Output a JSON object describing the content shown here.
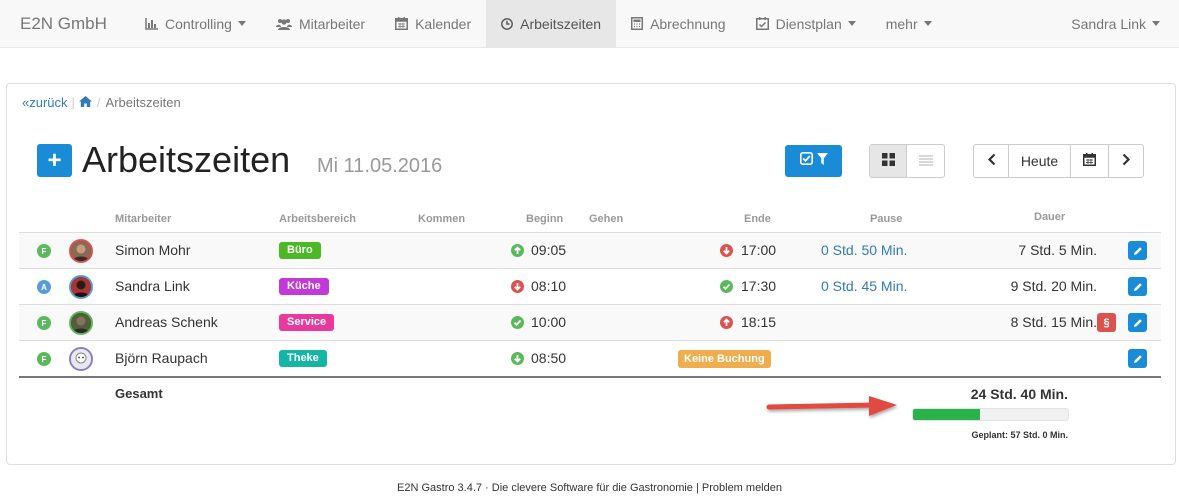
{
  "navbar": {
    "brand": "E2N GmbH",
    "items": [
      {
        "label": "Controlling",
        "icon": "bar-chart-icon",
        "dropdown": true
      },
      {
        "label": "Mitarbeiter",
        "icon": "users-icon",
        "dropdown": false
      },
      {
        "label": "Kalender",
        "icon": "calendar-icon",
        "dropdown": false
      },
      {
        "label": "Arbeitszeiten",
        "icon": "clock-icon",
        "dropdown": false,
        "active": true
      },
      {
        "label": "Abrechnung",
        "icon": "calculator-icon",
        "dropdown": false
      },
      {
        "label": "Dienstplan",
        "icon": "calendar-check-icon",
        "dropdown": true
      },
      {
        "label": "mehr",
        "dropdown": true
      }
    ],
    "user": "Sandra Link"
  },
  "breadcrumb": {
    "back": "zurück",
    "current": "Arbeitszeiten"
  },
  "header": {
    "add_label": "+",
    "title": "Arbeitszeiten",
    "date": "Mi 11.05.2016"
  },
  "toolbar": {
    "today": "Heute"
  },
  "table": {
    "columns": {
      "mitarbeiter": "Mitarbeiter",
      "arbeitsbereich": "Arbeitsbereich",
      "kommen": "Kommen",
      "beginn": "Beginn",
      "gehen": "Gehen",
      "ende": "Ende",
      "pause": "Pause",
      "dauer": "Dauer"
    },
    "rows": [
      {
        "status": "F",
        "status_color": "#5cb85c",
        "name": "Simon Mohr",
        "area": "Büro",
        "area_color": "#4cb826",
        "begin": "09:05",
        "begin_icon": "arrow-up",
        "end": "17:00",
        "end_icon": "arrow-down",
        "pause": "0 Std. 50 Min.",
        "dauer": "7 Std. 5 Min.",
        "avatar_border": "#d9534f"
      },
      {
        "status": "A",
        "status_color": "#5b9bd5",
        "name": "Sandra Link",
        "area": "Küche",
        "area_color": "#c13ad8",
        "begin": "08:10",
        "begin_icon": "arrow-down",
        "end": "17:30",
        "end_icon": "check",
        "pause": "0 Std. 45 Min.",
        "dauer": "9 Std. 20 Min.",
        "avatar_border": "#5b9bd5"
      },
      {
        "status": "F",
        "status_color": "#5cb85c",
        "name": "Andreas Schenk",
        "area": "Service",
        "area_color": "#e83a9c",
        "begin": "10:00",
        "begin_icon": "check",
        "end": "18:15",
        "end_icon": "arrow-up",
        "pause": "",
        "dauer": "8 Std. 15 Min.",
        "avatar_border": "#5cb85c",
        "paragraph": "§"
      },
      {
        "status": "F",
        "status_color": "#5cb85c",
        "name": "Björn Raupach",
        "area": "Theke",
        "area_color": "#14b5a5",
        "begin": "08:50",
        "begin_icon": "arrow-down-green",
        "end": "",
        "end_badge": "Keine Buchung",
        "pause": "",
        "dauer": "",
        "avatar_border": "#8e7cc3"
      }
    ],
    "total_label": "Gesamt",
    "total_value": "24 Std. 40 Min.",
    "progress_percent": 43,
    "planned": "Geplant: 57 Std. 0 Min."
  },
  "footer": {
    "text": "E2N Gastro 3.4.7 · Die clevere Software für die Gastronomie | Problem melden"
  },
  "colors": {
    "primary": "#1a8bd6",
    "progress": "#29b34a",
    "warning": "#f0ad4e",
    "danger": "#d9534f"
  }
}
